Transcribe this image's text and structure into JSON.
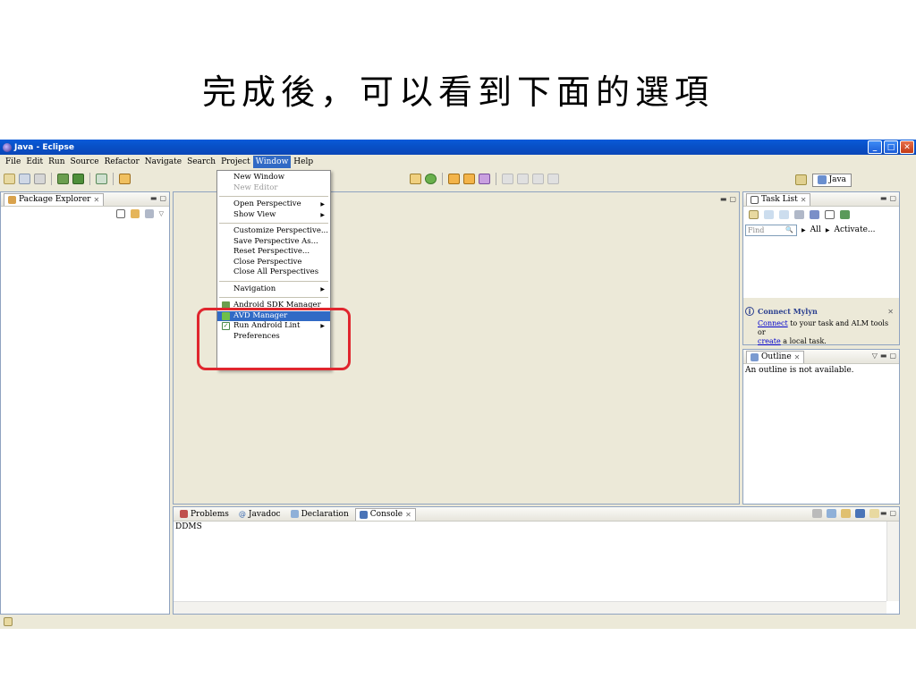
{
  "slide_title": "完成後，可以看到下面的選項",
  "window": {
    "title": "Java - Eclipse",
    "min": "_",
    "max": "□",
    "close": "✕"
  },
  "menubar": [
    "File",
    "Edit",
    "Run",
    "Source",
    "Refactor",
    "Navigate",
    "Search",
    "Project",
    "Window",
    "Help"
  ],
  "perspective": {
    "java_label": "Java"
  },
  "window_menu": {
    "group1": [
      "New Window",
      "New Editor"
    ],
    "group2": [
      "Open Perspective",
      "Show View"
    ],
    "group3": [
      "Customize Perspective...",
      "Save Perspective As...",
      "Reset Perspective...",
      "Close Perspective",
      "Close All Perspectives"
    ],
    "group4": [
      "Navigation"
    ],
    "group5": [
      "Android SDK Manager",
      "AVD Manager",
      "Run Android Lint",
      "Preferences"
    ]
  },
  "package_explorer": {
    "tab": "Package Explorer"
  },
  "task_list": {
    "tab": "Task List",
    "find_placeholder": "Find",
    "all": "All",
    "activate": "Activate...",
    "mylyn_title": "Connect Mylyn",
    "mylyn_connect": "Connect",
    "mylyn_text1": " to your task and ALM tools or",
    "mylyn_create": "create",
    "mylyn_text2": " a local task."
  },
  "outline": {
    "tab": "Outline",
    "message": "An outline is not available."
  },
  "console": {
    "tabs": [
      "Problems",
      "Javadoc",
      "Declaration",
      "Console"
    ],
    "content": "DDMS"
  },
  "colors": {
    "highlight": "#316ac5",
    "annotation": "#e0262e",
    "titlebar": "#0a5bd9"
  }
}
